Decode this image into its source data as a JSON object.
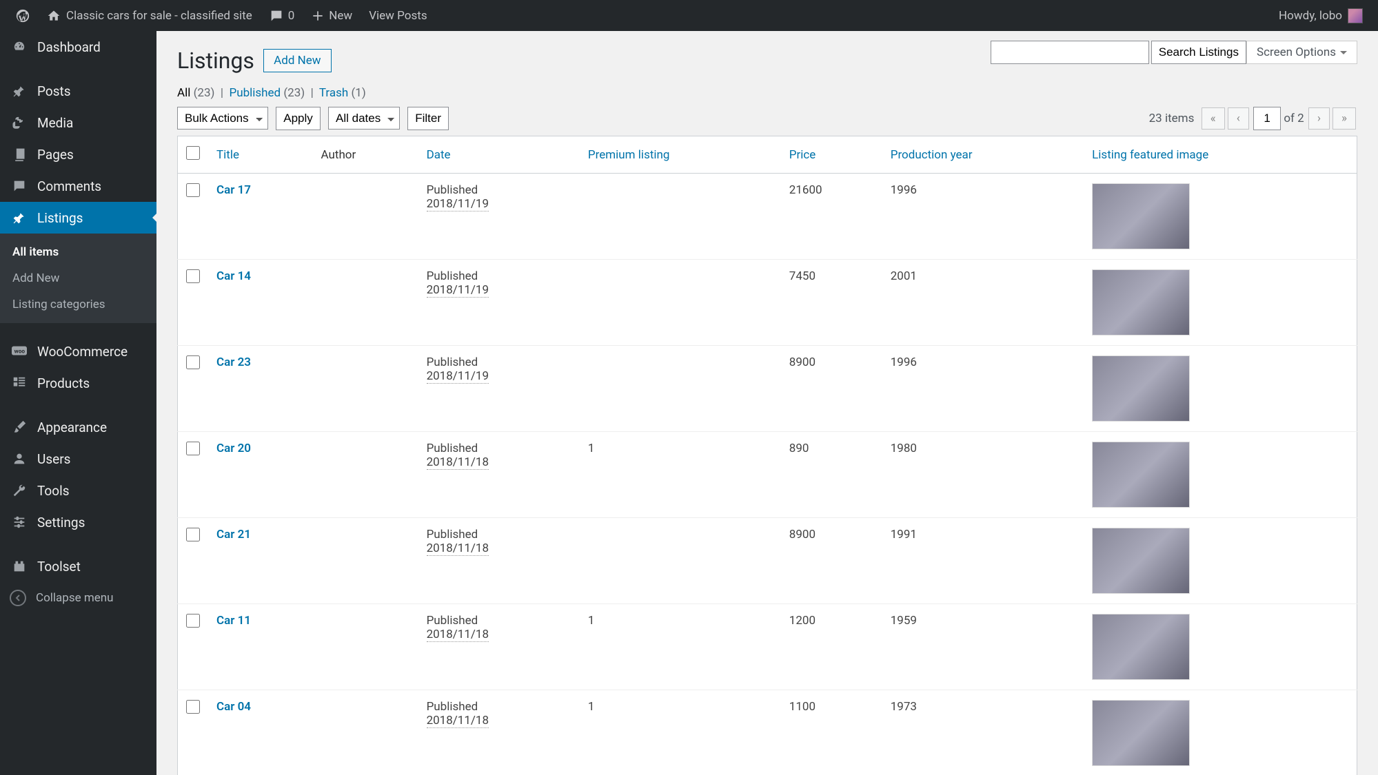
{
  "adminbar": {
    "site": "Classic cars for sale - classified site",
    "comments": "0",
    "new": "New",
    "viewposts": "View Posts",
    "howdy": "Howdy, lobo"
  },
  "sidebar": {
    "dashboard": "Dashboard",
    "posts": "Posts",
    "media": "Media",
    "pages": "Pages",
    "comments": "Comments",
    "listings": "Listings",
    "sub_all": "All items",
    "sub_add": "Add New",
    "sub_cats": "Listing categories",
    "woo": "WooCommerce",
    "products": "Products",
    "appearance": "Appearance",
    "users": "Users",
    "tools": "Tools",
    "settings": "Settings",
    "toolset": "Toolset",
    "collapse": "Collapse menu"
  },
  "page": {
    "title": "Listings",
    "add_new": "Add New",
    "screen_options": "Screen Options",
    "search_btn": "Search Listings"
  },
  "filters": {
    "all": "All",
    "all_count": "(23)",
    "published": "Published",
    "published_count": "(23)",
    "trash": "Trash",
    "trash_count": "(1)",
    "bulk": "Bulk Actions",
    "apply": "Apply",
    "all_dates": "All dates",
    "filter": "Filter"
  },
  "pagination": {
    "items": "23 items",
    "current": "1",
    "of": "of 2"
  },
  "cols": {
    "title": "Title",
    "author": "Author",
    "date": "Date",
    "premium": "Premium listing",
    "price": "Price",
    "year": "Production year",
    "image": "Listing featured image"
  },
  "rows": [
    {
      "title": "Car 17",
      "status": "Published",
      "date": "2018/11/19",
      "premium": "",
      "price": "21600",
      "year": "1996"
    },
    {
      "title": "Car 14",
      "status": "Published",
      "date": "2018/11/19",
      "premium": "",
      "price": "7450",
      "year": "2001"
    },
    {
      "title": "Car 23",
      "status": "Published",
      "date": "2018/11/19",
      "premium": "",
      "price": "8900",
      "year": "1996"
    },
    {
      "title": "Car 20",
      "status": "Published",
      "date": "2018/11/18",
      "premium": "1",
      "price": "890",
      "year": "1980"
    },
    {
      "title": "Car 21",
      "status": "Published",
      "date": "2018/11/18",
      "premium": "",
      "price": "8900",
      "year": "1991"
    },
    {
      "title": "Car 11",
      "status": "Published",
      "date": "2018/11/18",
      "premium": "1",
      "price": "1200",
      "year": "1959"
    },
    {
      "title": "Car 04",
      "status": "Published",
      "date": "2018/11/18",
      "premium": "1",
      "price": "1100",
      "year": "1973"
    }
  ]
}
